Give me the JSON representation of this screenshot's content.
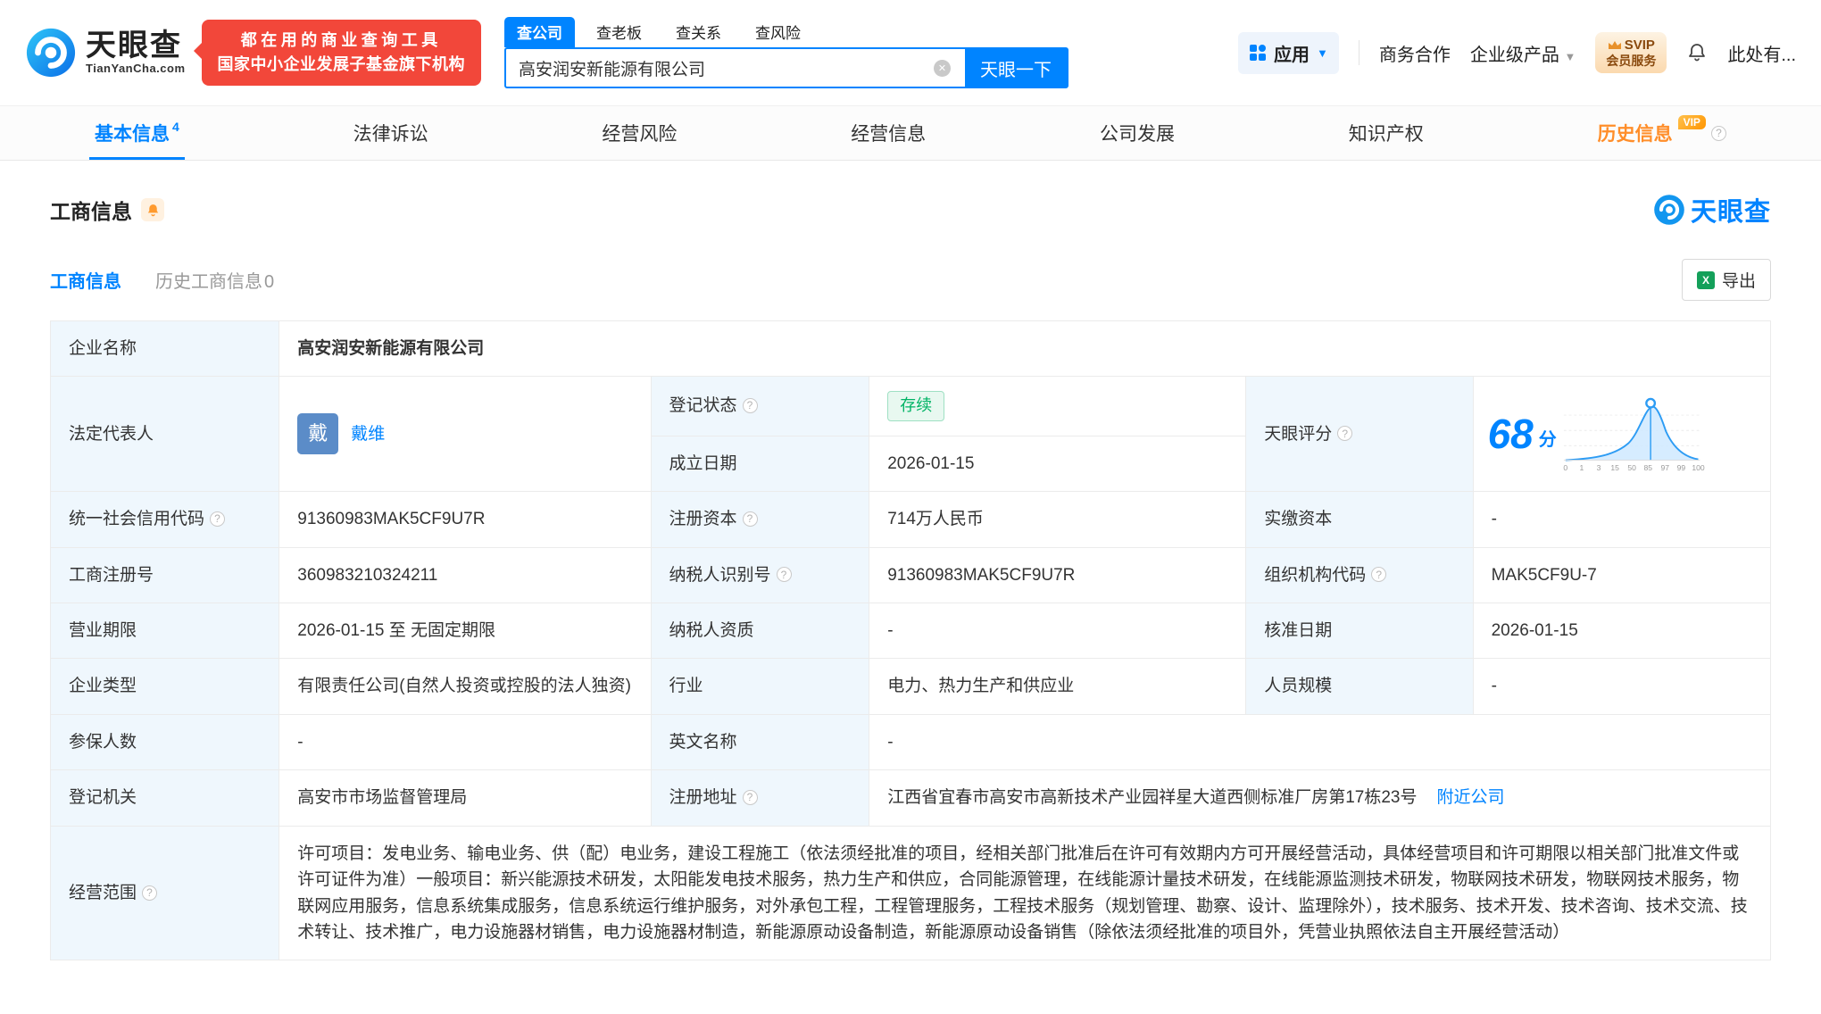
{
  "colors": {
    "primary_blue": "#0084ff",
    "banner_red": "#f2473a",
    "status_green": "#00b365",
    "vip_orange": "#ff8e2a",
    "label_bg": "#eff7fd"
  },
  "header": {
    "logo": {
      "cn": "天眼查",
      "en": "TianYanCha.com"
    },
    "banner": {
      "line1": "都在用的商业查询工具",
      "line2": "国家中小企业发展子基金旗下机构"
    },
    "search": {
      "tabs": [
        {
          "label": "查公司"
        },
        {
          "label": "查老板"
        },
        {
          "label": "查关系"
        },
        {
          "label": "查风险"
        }
      ],
      "value": "高安润安新能源有限公司",
      "button": "天眼一下"
    },
    "menu": {
      "apps": "应用",
      "cooperation": "商务合作",
      "enterprise": "企业级产品",
      "svip_line1": "SVIP",
      "svip_line2": "会员服务",
      "more": "此处有..."
    }
  },
  "nav": {
    "tabs": [
      {
        "label": "基本信息",
        "badge": "4"
      },
      {
        "label": "法律诉讼"
      },
      {
        "label": "经营风险"
      },
      {
        "label": "经营信息"
      },
      {
        "label": "公司发展"
      },
      {
        "label": "知识产权"
      },
      {
        "label": "历史信息",
        "vip": "VIP"
      }
    ]
  },
  "section": {
    "title": "工商信息",
    "watermark": "天眼查",
    "subtab_active": "工商信息",
    "subtab_history": "历史工商信息",
    "subtab_history_count": "0",
    "export": "导出"
  },
  "company": {
    "name_label": "企业名称",
    "name": "高安润安新能源有限公司",
    "legal_rep_label": "法定代表人",
    "legal_rep_avatar": "戴",
    "legal_rep": "戴维",
    "reg_status_label": "登记状态",
    "reg_status": "存续",
    "score_label": "天眼评分",
    "score": "68",
    "score_unit": "分",
    "est_date_label": "成立日期",
    "est_date": "2026-01-15",
    "credit_code_label": "统一社会信用代码",
    "credit_code": "91360983MAK5CF9U7R",
    "reg_capital_label": "注册资本",
    "reg_capital": "714万人民币",
    "paid_capital_label": "实缴资本",
    "paid_capital": "-",
    "reg_number_label": "工商注册号",
    "reg_number": "360983210324211",
    "taxpayer_id_label": "纳税人识别号",
    "taxpayer_id": "91360983MAK5CF9U7R",
    "org_code_label": "组织机构代码",
    "org_code": "MAK5CF9U-7",
    "business_term_label": "营业期限",
    "business_term": "2026-01-15 至 无固定期限",
    "taxpayer_quality_label": "纳税人资质",
    "taxpayer_quality": "-",
    "approval_date_label": "核准日期",
    "approval_date": "2026-01-15",
    "company_type_label": "企业类型",
    "company_type": "有限责任公司(自然人投资或控股的法人独资)",
    "industry_label": "行业",
    "industry": "电力、热力生产和供应业",
    "staff_size_label": "人员规模",
    "staff_size": "-",
    "insured_label": "参保人数",
    "insured": "-",
    "english_name_label": "英文名称",
    "english_name": "-",
    "reg_authority_label": "登记机关",
    "reg_authority": "高安市市场监督管理局",
    "address_label": "注册地址",
    "address": "江西省宜春市高安市高新技术产业园祥星大道西侧标准厂房第17栋23号",
    "nearby_link": "附近公司",
    "business_scope_label": "经营范围",
    "business_scope": "许可项目：发电业务、输电业务、供（配）电业务，建设工程施工（依法须经批准的项目，经相关部门批准后在许可有效期内方可开展经营活动，具体经营项目和许可期限以相关部门批准文件或许可证件为准）一般项目：新兴能源技术研发，太阳能发电技术服务，热力生产和供应，合同能源管理，在线能源计量技术研发，在线能源监测技术研发，物联网技术研发，物联网技术服务，物联网应用服务，信息系统集成服务，信息系统运行维护服务，对外承包工程，工程管理服务，工程技术服务（规划管理、勘察、设计、监理除外），技术服务、技术开发、技术咨询、技术交流、技术转让、技术推广，电力设施器材销售，电力设施器材制造，新能源原动设备制造，新能源原动设备销售（除依法须经批准的项目外，凭营业执照依法自主开展经营活动）"
  },
  "score_chart": {
    "type": "area",
    "axis_labels": [
      "0",
      "1",
      "3",
      "15",
      "50",
      "85",
      "97",
      "99",
      "100"
    ]
  }
}
